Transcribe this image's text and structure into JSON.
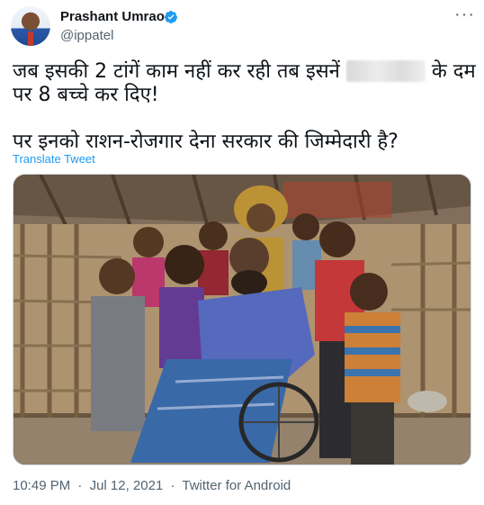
{
  "author": {
    "name": "Prashant Umrao",
    "handle": "@ippatel",
    "verified": true,
    "avatar_icon": "avatar"
  },
  "tweet": {
    "line1_before_blur": "जब इसकी 2 टांगें काम नहीं कर रही तब इसनें",
    "line1_after_blur": "के दम",
    "line2": "पर 8 बच्चे कर दिए!",
    "line3": "पर इनको राशन-रोजगार देना सरकार की जिम्मेदारी है?",
    "translate_label": "Translate Tweet"
  },
  "meta": {
    "time": "10:49 PM",
    "separator": "·",
    "date": "Jul 12, 2021",
    "client": "Twitter for Android"
  },
  "colors": {
    "link": "#1d9bf0",
    "secondary_text": "#536471",
    "verified_badge": "#1d9bf0"
  }
}
